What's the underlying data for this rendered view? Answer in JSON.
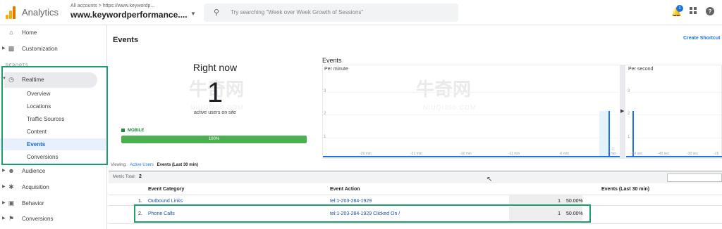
{
  "header": {
    "app_name": "Analytics",
    "account_path": "All accounts > https://www.keywordp...",
    "account_name": "www.keywordperformance....",
    "search_placeholder": "Try searching \"Week over Week Growth of Sessions\"",
    "notification_count": "1"
  },
  "sidebar": {
    "home": "Home",
    "customization": "Customization",
    "reports_label": "REPORTS",
    "realtime": "Realtime",
    "realtime_items": [
      "Overview",
      "Locations",
      "Traffic Sources",
      "Content",
      "Events",
      "Conversions"
    ],
    "audience": "Audience",
    "acquisition": "Acquisition",
    "behavior": "Behavior",
    "conversions": "Conversions"
  },
  "main": {
    "title": "Events",
    "create_shortcut": "Create Shortcut",
    "right_now": {
      "title": "Right now",
      "count": "1",
      "subtitle": "active users on site",
      "device_label": "MOBILE",
      "device_percent": "100%"
    },
    "chart": {
      "title": "Events",
      "per_minute_label": "Per minute",
      "per_second_label": "Per second",
      "y_ticks": [
        "3",
        "2",
        "1"
      ],
      "minute_ticks": [
        "-26 min",
        "-21 min",
        "-16 min",
        "-11 min",
        "-6 min",
        "-1 min"
      ],
      "second_ticks": [
        "-60 sec",
        "-45 sec",
        "-30 sec",
        "-15"
      ]
    },
    "viewing": {
      "label": "Viewing:",
      "option_active_users": "Active Users",
      "option_events": "Events (Last 30 min)"
    },
    "metric_total_label": "Metric Total:",
    "metric_total_value": "2",
    "table": {
      "headers": [
        "Event Category",
        "Event Action",
        "Events (Last 30 min)"
      ],
      "rows": [
        {
          "index": "1.",
          "category": "Outbound Links",
          "action": "tel:1-203-284-1929",
          "count": "1",
          "percent": "50.00%"
        },
        {
          "index": "2.",
          "category": "Phone Calls",
          "action": "tel:1-203-284-1929 Clicked On /",
          "count": "1",
          "percent": "50.00%"
        }
      ]
    },
    "watermark": {
      "text": "牛奇网",
      "sub": "NIUQI360.COM"
    }
  }
}
